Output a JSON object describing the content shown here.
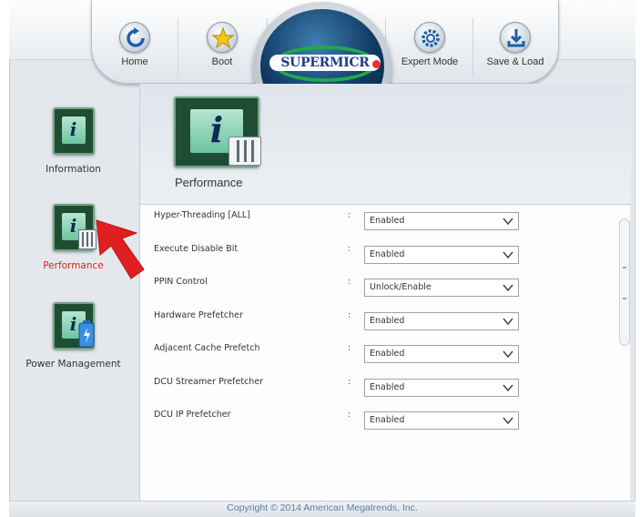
{
  "nav": {
    "items": [
      {
        "label": "Home",
        "icon": "refresh-icon"
      },
      {
        "label": "Boot",
        "icon": "star-icon"
      },
      {
        "label": "Expert Mode",
        "icon": "gear-icon"
      },
      {
        "label": "Save & Load",
        "icon": "download-icon"
      }
    ],
    "logo_text": "SUPERMICR",
    "logo_dot_color": "#e53030"
  },
  "sidebar": {
    "items": [
      {
        "label": "Information",
        "icon": "info-chip-icon",
        "active": false
      },
      {
        "label": "Performance",
        "icon": "performance-chip-icon",
        "active": true
      },
      {
        "label": "Power Management",
        "icon": "power-chip-icon",
        "active": false
      }
    ],
    "active_color": "#e02020"
  },
  "content": {
    "title": "Performance",
    "settings": [
      {
        "name": "Hyper-Threading [ALL]",
        "value": "Enabled"
      },
      {
        "name": "Execute Disable Bit",
        "value": "Enabled"
      },
      {
        "name": "PPIN Control",
        "value": "Unlock/Enable"
      },
      {
        "name": "Hardware Prefetcher",
        "value": "Enabled"
      },
      {
        "name": "Adjacent Cache Prefetch",
        "value": "Enabled"
      },
      {
        "name": "DCU Streamer Prefetcher",
        "value": "Enabled"
      },
      {
        "name": "DCU IP Prefetcher",
        "value": "Enabled"
      }
    ],
    "separator": ":"
  },
  "footer": {
    "copyright": "Copyright © 2014 American Megatrends, Inc."
  },
  "pointer": {
    "icon": "red-arrow-pointer-icon",
    "color": "#e02020"
  }
}
